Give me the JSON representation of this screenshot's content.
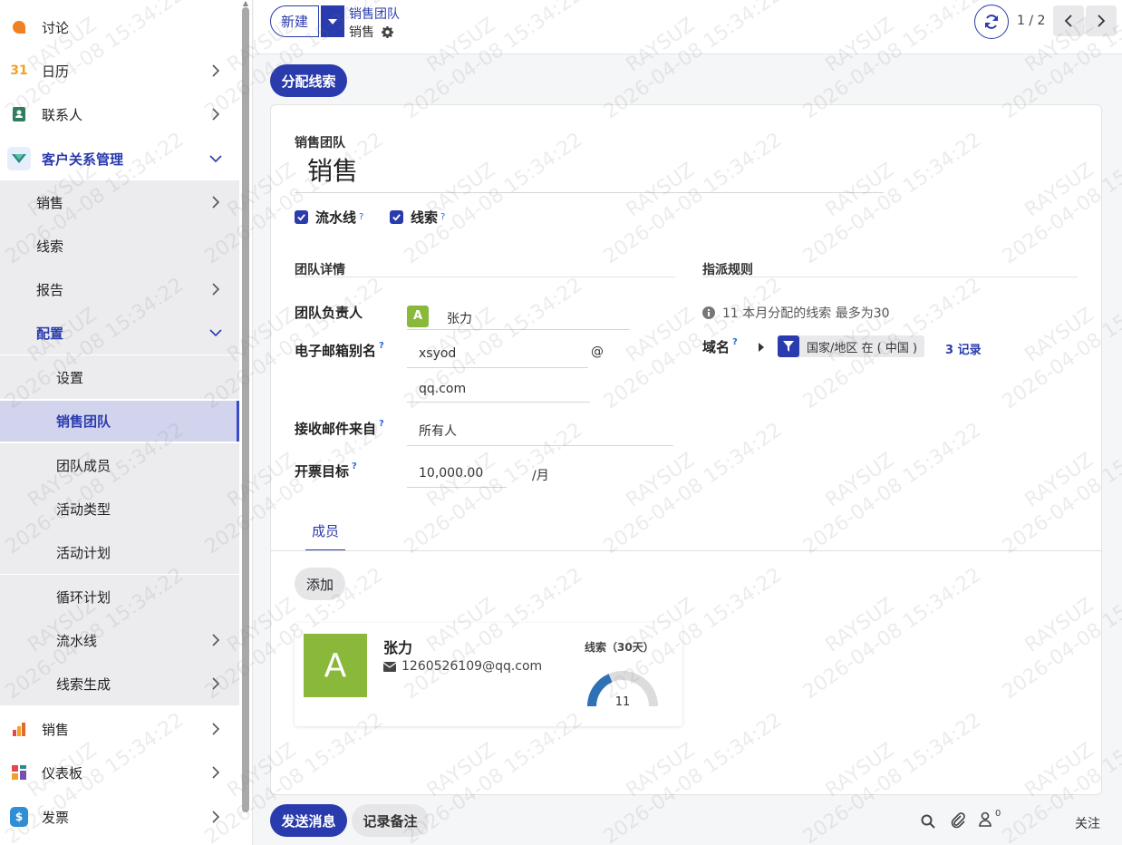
{
  "sidebar": {
    "items": [
      {
        "label": "讨论",
        "icon": "discuss-icon",
        "has_chevron": false
      },
      {
        "label": "日历",
        "icon": "calendar-icon",
        "icon_text": "31",
        "has_chevron": true
      },
      {
        "label": "联系人",
        "icon": "contacts-icon",
        "has_chevron": true
      },
      {
        "label": "客户关系管理",
        "icon": "crm-icon",
        "has_chevron": true,
        "expanded": true
      },
      {
        "label": "销售",
        "level": 1,
        "has_chevron": true
      },
      {
        "label": "线索",
        "level": 1,
        "has_chevron": false
      },
      {
        "label": "报告",
        "level": 1,
        "has_chevron": true
      },
      {
        "label": "配置",
        "level": 1,
        "has_chevron": true,
        "expanded": true
      },
      {
        "label": "设置",
        "level": 2
      },
      {
        "label": "销售团队",
        "level": 2,
        "selected": true
      },
      {
        "label": "团队成员",
        "level": 2
      },
      {
        "label": "活动类型",
        "level": 2
      },
      {
        "label": "活动计划",
        "level": 2
      },
      {
        "label": "循环计划",
        "level": 2
      },
      {
        "label": "流水线",
        "level": 2,
        "has_chevron": true
      },
      {
        "label": "线索生成",
        "level": 2,
        "has_chevron": true
      },
      {
        "label": "销售",
        "icon": "sales-icon",
        "has_chevron": true
      },
      {
        "label": "仪表板",
        "icon": "dashboard-icon",
        "has_chevron": true
      },
      {
        "label": "发票",
        "icon": "invoice-icon",
        "icon_text": "$",
        "has_chevron": true
      }
    ]
  },
  "topbar": {
    "new_label": "新建",
    "breadcrumb_parent": "销售团队",
    "breadcrumb_current": "销售",
    "pager": "1 / 2"
  },
  "actions": {
    "assign_leads": "分配线索"
  },
  "form": {
    "name_label": "销售团队",
    "name_value": "销售",
    "pipeline_label": "流水线",
    "leads_label": "线索",
    "section_details": "团队详情",
    "section_rules": "指派规则",
    "leader_label": "团队负责人",
    "leader_avatar": "A",
    "leader_value": "张力",
    "email_alias_label": "电子邮箱别名",
    "email_alias_value": "xsyod",
    "email_at": "@",
    "email_domain": "qq.com",
    "accept_from_label": "接收邮件来自",
    "accept_from_value": "所有人",
    "invoice_target_label": "开票目标",
    "invoice_target_value": "10,000.00",
    "invoice_target_unit": "/月",
    "assignment_info": "11 本月分配的线索 最多为30",
    "domain_label": "域名",
    "domain_filter": "国家/地区 在 ( 中国 )",
    "domain_records": "3 记录",
    "tab_members": "成员",
    "add_label": "添加",
    "member": {
      "avatar": "A",
      "name": "张力",
      "email": "1260526109@qq.com",
      "gauge_title": "线索（30天）",
      "gauge_value": "11",
      "gauge_fraction": 0.37
    }
  },
  "footer": {
    "send_message": "发送消息",
    "log_note": "记录备注",
    "follower_count": "0",
    "follow": "关注"
  },
  "watermark": {
    "line1": "RAYSUZ",
    "line2": "2026-04-08 15:34:22"
  },
  "colors": {
    "primary": "#2a3bad",
    "avatar_green": "#8ab83a",
    "gauge_blue": "#2f71b6",
    "gauge_gray": "#dcdcdc"
  }
}
